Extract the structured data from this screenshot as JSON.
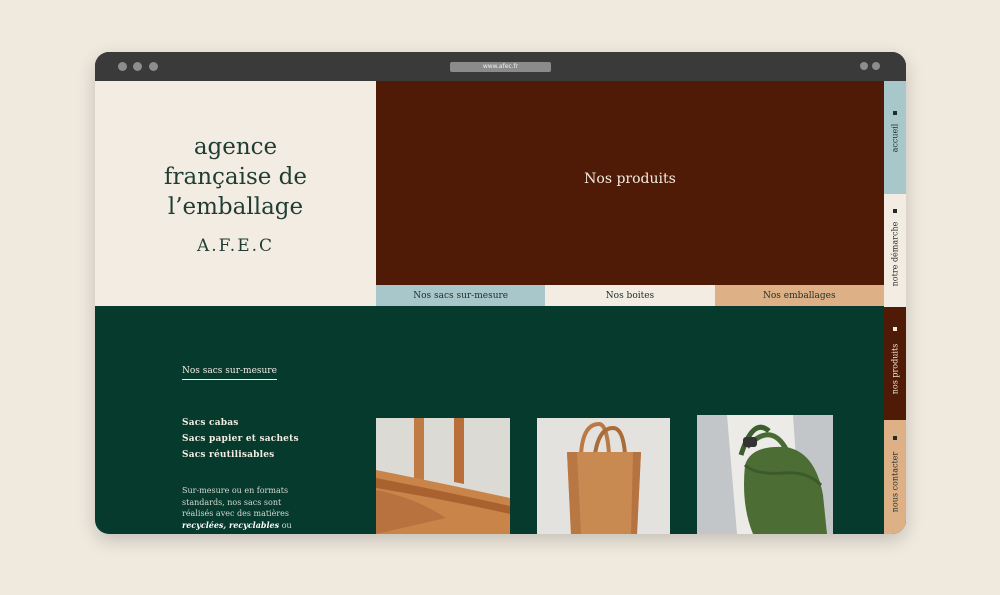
{
  "browser": {
    "url": "www.afec.fr"
  },
  "brand": {
    "name_lines": [
      "agence",
      "française de",
      "l’emballage"
    ],
    "short": "A.F.E.C"
  },
  "hero": {
    "title": "Nos produits"
  },
  "category_tabs": [
    {
      "label": "Nos sacs sur-mesure",
      "color": "#a8c7cb"
    },
    {
      "label": "Nos boites",
      "color": "#f3ece2"
    },
    {
      "label": "Nos emballages",
      "color": "#deb085"
    }
  ],
  "side_nav": [
    {
      "label": "accueil",
      "color": "#a8c7cb"
    },
    {
      "label": "notre démarche",
      "color": "#f3ece2"
    },
    {
      "label": "nos produits",
      "color": "#4f1a06"
    },
    {
      "label": "nous contacter",
      "color": "#deb085"
    }
  ],
  "section": {
    "title": "Nos sacs sur-mesure",
    "items": [
      "Sacs cabas",
      "Sacs papier et sachets",
      "Sacs réutilisables"
    ],
    "description": {
      "plain": "Sur-mesure ou en formats standards, nos sacs sont réalisés avec des matières",
      "emphasis": "recyclées, recyclables",
      "tail": "ou"
    }
  },
  "colors": {
    "background": "#efe9de",
    "cream": "#f3ece2",
    "brown": "#4f1a06",
    "green": "#053a2c",
    "blue": "#a8c7cb",
    "tan": "#deb085"
  }
}
